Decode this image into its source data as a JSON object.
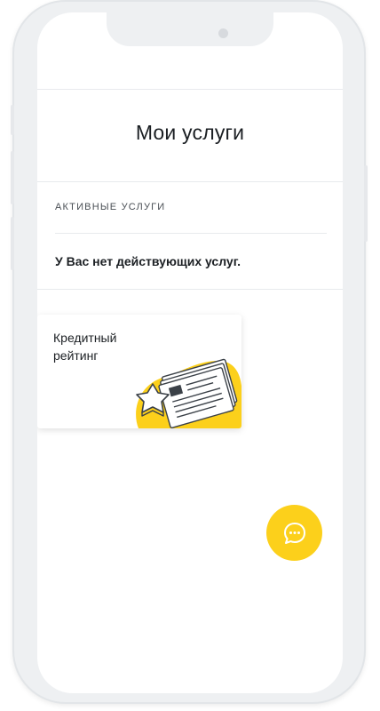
{
  "header": {
    "title": "Мои услуги"
  },
  "active_services": {
    "section_label": "АКТИВНЫЕ УСЛУГИ",
    "empty_message": "У Вас нет действующих услуг."
  },
  "cards": [
    {
      "title": "Кредитный рейтинг",
      "illustration": "credit-report-illustration"
    }
  ],
  "chat": {
    "icon": "chat-bubble-icon"
  },
  "colors": {
    "accent": "#fcd01b",
    "text": "#1b1f23",
    "frame": "#eef0f2"
  }
}
